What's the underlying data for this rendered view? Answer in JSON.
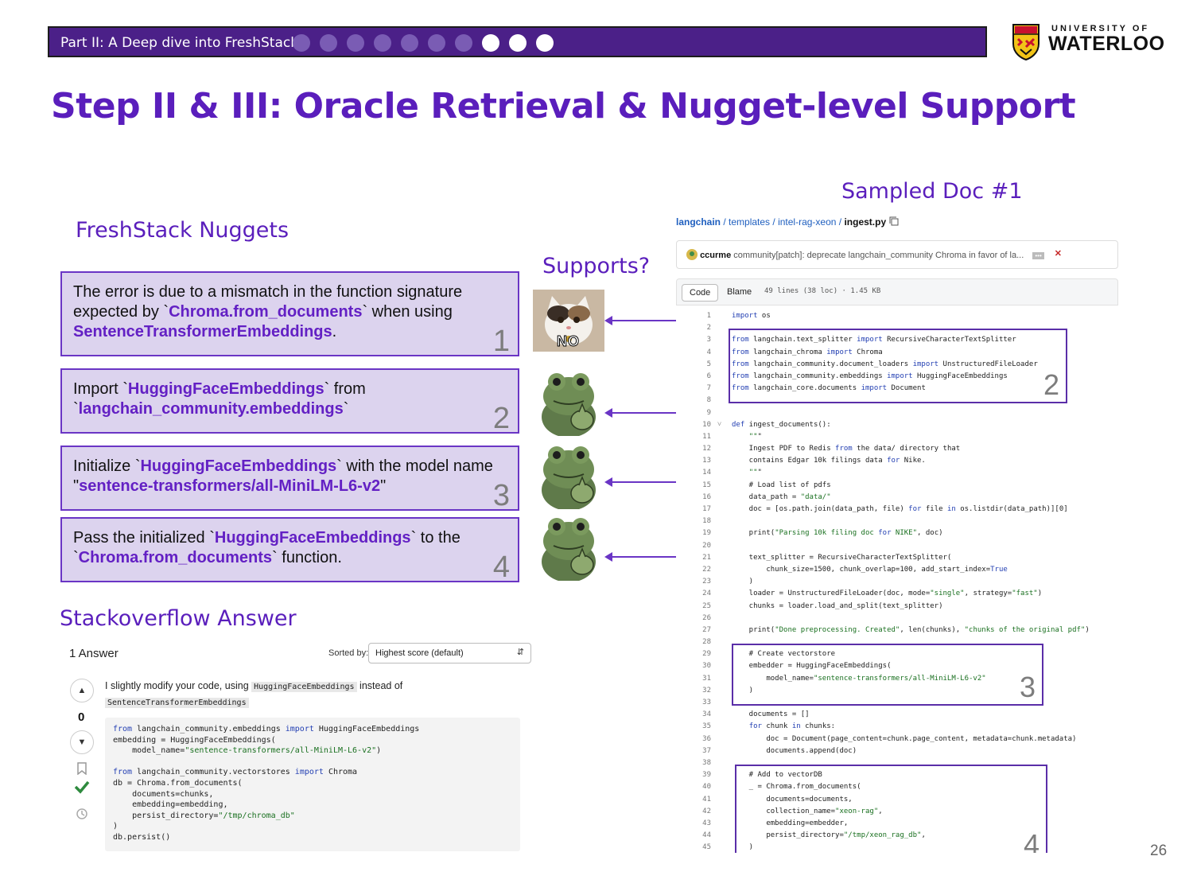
{
  "header": {
    "section": "Part II: A Deep dive into FreshStack",
    "progress": {
      "total": 10,
      "current_from": 8
    }
  },
  "logo": {
    "top": "UNIVERSITY OF",
    "main": "WATERLOO"
  },
  "title": "Step II & III: Oracle Retrieval & Nugget-level Support",
  "labels": {
    "nuggets": "FreshStack Nuggets",
    "supports": "Supports?",
    "sampled_doc": "Sampled Doc #1",
    "stackoverflow": "Stackoverflow Answer"
  },
  "nuggets": [
    {
      "number": "1",
      "reaction": "NO"
    },
    {
      "number": "2"
    },
    {
      "number": "3"
    },
    {
      "number": "4"
    }
  ],
  "nugget_text": {
    "n1_a": "The error is due to a mismatch in the function signature expected by `",
    "n1_b": "Chroma.from_documents",
    "n1_c": "` when using ",
    "n1_d": "SentenceTransformerEmbeddings",
    "n1_e": ".",
    "n2_a": "Import `",
    "n2_b": "HuggingFaceEmbeddings",
    "n2_c": "` from `",
    "n2_d": "langchain_community.embeddings",
    "n2_e": "`",
    "n3_a": "Initialize `",
    "n3_b": "HuggingFaceEmbeddings",
    "n3_c": "` with the model name \"",
    "n3_d": "sentence-transformers/all-MiniLM-L6-v2",
    "n3_e": "\"",
    "n4_a": "Pass the initialized `",
    "n4_b": "HuggingFaceEmbeddings",
    "n4_c": "` to the `",
    "n4_d": "Chroma.from_documents",
    "n4_e": "` function."
  },
  "stackoverflow": {
    "answer_count": "1 Answer",
    "sorted_by_label": "Sorted by:",
    "sort_value": "Highest score (default)",
    "score": "0",
    "text_a": "I slightly modify your code, using ",
    "text_code1": "HuggingFaceEmbeddings",
    "text_b": " instead of ",
    "text_code2": "SentenceTransformerEmbeddings"
  },
  "github": {
    "crumb_repo": "langchain",
    "crumb_dir1": "templates",
    "crumb_dir2": "intel-rag-xeon",
    "crumb_file": "ingest.py",
    "commit_user": "ccurme",
    "commit_msg": "community[patch]: deprecate langchain_community Chroma in favor of la...",
    "tab_code": "Code",
    "tab_blame": "Blame",
    "file_info": "49 lines (38 loc) · 1.45 KB",
    "lines": [
      "import os",
      "",
      "from langchain.text_splitter import RecursiveCharacterTextSplitter",
      "from langchain_chroma import Chroma",
      "from langchain_community.document_loaders import UnstructuredFileLoader",
      "from langchain_community.embeddings import HuggingFaceEmbeddings",
      "from langchain_core.documents import Document",
      "",
      "",
      "def ingest_documents():",
      "    \"\"\"",
      "    Ingest PDF to Redis from the data/ directory that",
      "    contains Edgar 10k filings data for Nike.",
      "    \"\"\"",
      "    # Load list of pdfs",
      "    data_path = \"data/\"",
      "    doc = [os.path.join(data_path, file) for file in os.listdir(data_path)][0]",
      "",
      "    print(\"Parsing 10k filing doc for NIKE\", doc)",
      "",
      "    text_splitter = RecursiveCharacterTextSplitter(",
      "        chunk_size=1500, chunk_overlap=100, add_start_index=True",
      "    )",
      "    loader = UnstructuredFileLoader(doc, mode=\"single\", strategy=\"fast\")",
      "    chunks = loader.load_and_split(text_splitter)",
      "",
      "    print(\"Done preprocessing. Created\", len(chunks), \"chunks of the original pdf\")",
      "",
      "    # Create vectorstore",
      "    embedder = HuggingFaceEmbeddings(",
      "        model_name=\"sentence-transformers/all-MiniLM-L6-v2\"",
      "    )",
      "",
      "    documents = []",
      "    for chunk in chunks:",
      "        doc = Document(page_content=chunk.page_content, metadata=chunk.metadata)",
      "        documents.append(doc)",
      "",
      "    # Add to vectorDB",
      "    _ = Chroma.from_documents(",
      "        documents=documents,",
      "        collection_name=\"xeon-rag\",",
      "        embedding=embedder,",
      "        persist_directory=\"/tmp/xeon_rag_db\",",
      "    )"
    ],
    "highlights": [
      {
        "number": "2",
        "from_line": 3,
        "to_line": 7
      },
      {
        "number": "3",
        "from_line": 29,
        "to_line": 32
      },
      {
        "number": "4",
        "from_line": 39,
        "to_line": 45
      }
    ]
  },
  "so_code_lines": [
    "from langchain_community.embeddings import HuggingFaceEmbeddings",
    "embedding = HuggingFaceEmbeddings(",
    "    model_name=\"sentence-transformers/all-MiniLM-L6-v2\")",
    "",
    "from langchain_community.vectorstores import Chroma",
    "db = Chroma.from_documents(",
    "    documents=chunks,",
    "    embedding=embedding,",
    "    persist_directory=\"/tmp/chroma_db\"",
    ")",
    "db.persist()"
  ],
  "page_number": "26",
  "colors": {
    "accent": "#5a1ebc",
    "bar": "#4b2088",
    "nugget_bg": "#dcd3ee"
  }
}
